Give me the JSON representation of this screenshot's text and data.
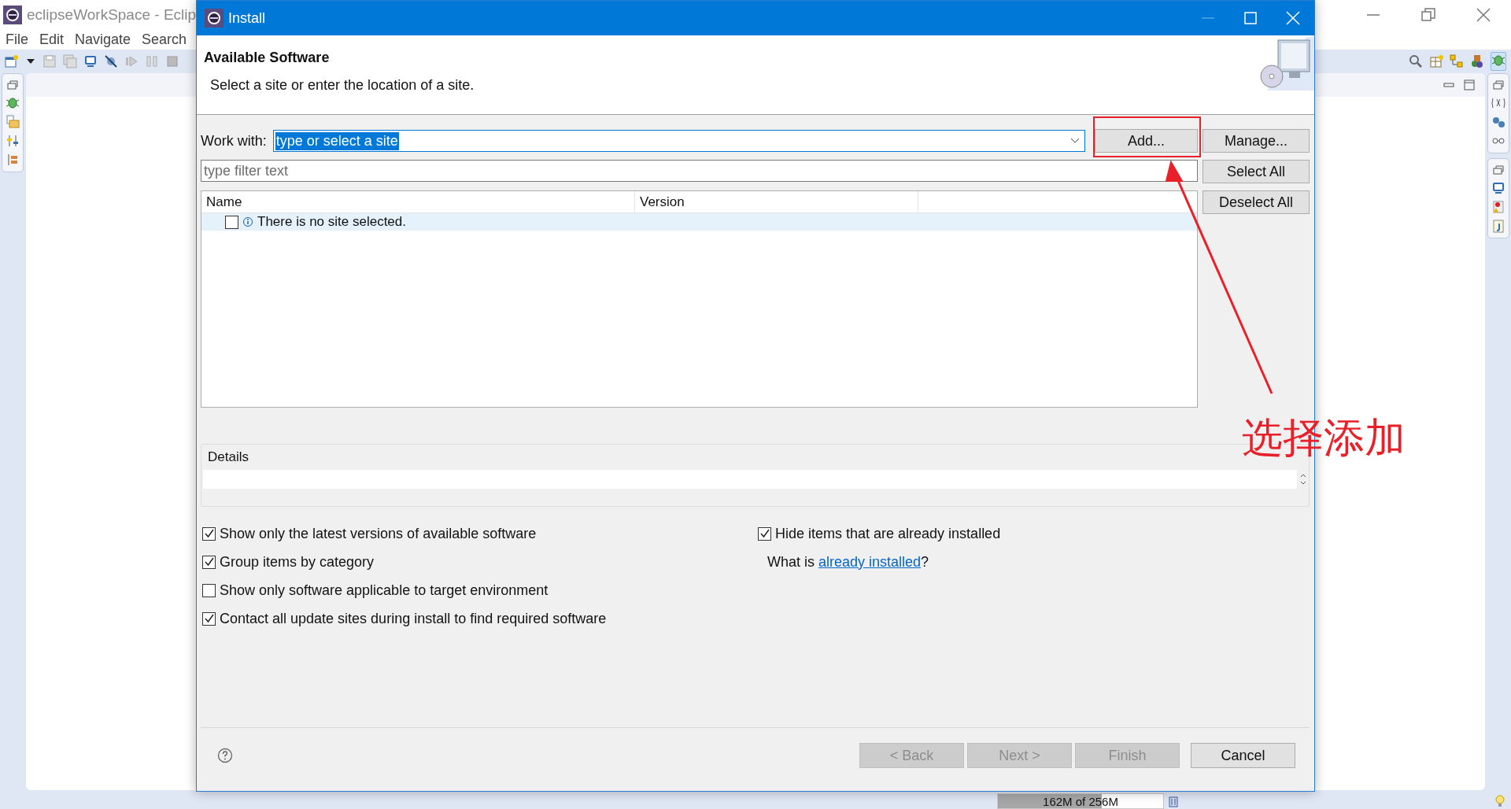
{
  "workbench": {
    "title": "eclipseWorkSpace - Eclip",
    "menu": [
      "File",
      "Edit",
      "Navigate",
      "Search"
    ],
    "memory": {
      "text": "162M of 256M",
      "level": 0.63
    }
  },
  "dialog": {
    "title": "Install",
    "heading": "Available Software",
    "description": "Select a site or enter the location of a site.",
    "work_with_label": "Work with:",
    "site": "type or select a site",
    "filter_placeholder": "type filter text",
    "side_buttons": [
      "Add...",
      "Manage...",
      "Select All",
      "Deselect All"
    ],
    "table": {
      "columns": [
        "Name",
        "Version"
      ],
      "rows": [
        {
          "text": "There is no site selected.",
          "checked": false,
          "selected": true
        }
      ]
    },
    "details_label": "Details",
    "options": [
      {
        "label": "Show only the latest versions of available software",
        "checked": true
      },
      {
        "label": "Group items by category",
        "checked": true
      },
      {
        "label": "Show only software applicable to target environment",
        "checked": false
      },
      {
        "label": "Contact all update sites during install to find required software",
        "checked": true
      }
    ],
    "right_options": [
      {
        "label": "Hide items that are already installed",
        "checked": true
      }
    ],
    "installed_link": {
      "before": "What is",
      "link": "already installed",
      "after": "?"
    },
    "buttons": [
      {
        "label": "< Back",
        "disabled": true
      },
      {
        "label": "Next >",
        "disabled": true
      },
      {
        "label": "Finish",
        "disabled": true
      },
      {
        "label": "Cancel",
        "disabled": false
      }
    ]
  },
  "annotation": {
    "label": "选择添加"
  }
}
